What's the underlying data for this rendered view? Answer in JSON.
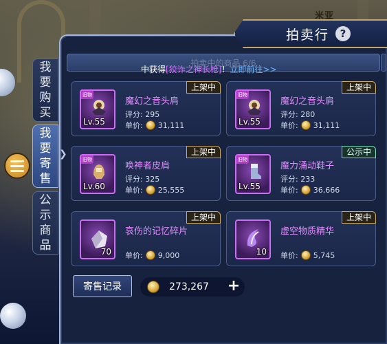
{
  "region": "米亚",
  "header": {
    "title": "拍卖行",
    "help": "?"
  },
  "side_tabs": [
    {
      "chars": [
        "我",
        "要",
        "购",
        "买"
      ],
      "active": false
    },
    {
      "chars": [
        "我",
        "要",
        "寄",
        "售"
      ],
      "active": true
    },
    {
      "chars": [
        "公",
        "示",
        "商",
        "品"
      ],
      "active": false
    }
  ],
  "status_bar": {
    "text": "拍卖中的商品 6/6"
  },
  "marquee": {
    "prefix": "中获得",
    "item": "[狡诈之神长枪]",
    "suffix": "！",
    "link": "立即前往>>"
  },
  "labels": {
    "score": "评分:",
    "price": "单价:",
    "rare": "旧物"
  },
  "listings": [
    {
      "name": "魔幻之音头肩",
      "level": "Lv.55",
      "score": "295",
      "price": "31,111",
      "status": "上架中",
      "status_type": "listed",
      "icon": "shoulder-armor-icon"
    },
    {
      "name": "魔幻之音头肩",
      "level": "Lv.55",
      "score": "280",
      "price": "31,111",
      "status": "上架中",
      "status_type": "listed",
      "icon": "shoulder-armor-icon"
    },
    {
      "name": "唤神者皮肩",
      "level": "Lv.60",
      "score": "325",
      "price": "25,555",
      "status": "上架中",
      "status_type": "listed",
      "icon": "leather-shoulder-icon"
    },
    {
      "name": "魔力涌动鞋子",
      "level": "Lv.55",
      "score": "233",
      "price": "36,666",
      "status": "公示中",
      "status_type": "public",
      "icon": "boots-icon"
    },
    {
      "name": "哀伤的记忆碎片",
      "qty": "70",
      "price": "9,000",
      "status": "上架中",
      "status_type": "listed",
      "icon": "crystal-shard-icon"
    },
    {
      "name": "虚空物质精华",
      "qty": "10",
      "price": "5,745",
      "status": "上架中",
      "status_type": "listed",
      "icon": "void-essence-icon"
    }
  ],
  "footer": {
    "consign_records": "寄售记录",
    "balance": "273,267",
    "plus": "+"
  },
  "colors": {
    "item_name": "#e889ff",
    "badge_listed": "#caa866",
    "badge_public": "#7fd8b9"
  }
}
